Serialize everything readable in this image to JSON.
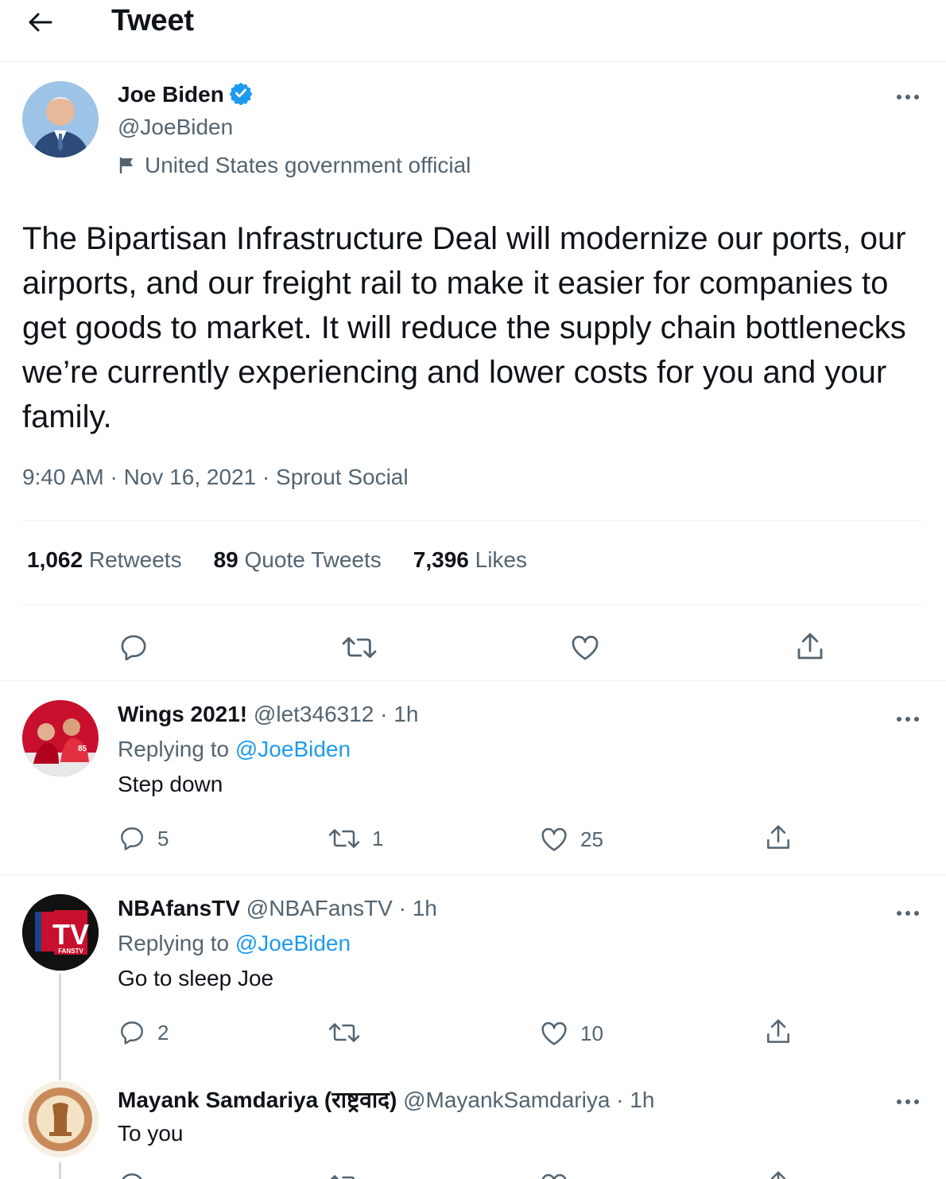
{
  "header": {
    "title": "Tweet"
  },
  "main_tweet": {
    "name": "Joe Biden",
    "handle": "@JoeBiden",
    "label": "United States government official",
    "text": "The Bipartisan Infrastructure Deal will modernize our ports, our airports, and our freight rail to make it easier for companies to get goods to market. It will reduce the supply chain bottlenecks we’re currently experiencing and lower costs for you and your family.",
    "meta": "9:40 AM · Nov 16, 2021 · Sprout Social",
    "stats": {
      "retweets_count": "1,062",
      "retweets_label": "Retweets",
      "quotes_count": "89",
      "quotes_label": "Quote Tweets",
      "likes_count": "7,396",
      "likes_label": "Likes"
    }
  },
  "replies": [
    {
      "name": "Wings 2021!",
      "handle": "@let346312",
      "time": "1h",
      "replying_prefix": "Replying to",
      "replying_to": "@JoeBiden",
      "text": "Step down",
      "reply_count": "5",
      "retweet_count": "1",
      "like_count": "25"
    },
    {
      "name": "NBAfansTV",
      "handle": "@NBAFansTV",
      "time": "1h",
      "replying_prefix": "Replying to",
      "replying_to": "@JoeBiden",
      "text": "Go to sleep Joe",
      "reply_count": "2",
      "retweet_count": "",
      "like_count": "10",
      "avatar_text": "TV",
      "avatar_subtext": "FANSTV"
    },
    {
      "name": "Mayank Samdariya (राष्ट्रवाद)",
      "handle": "@MayankSamdariya",
      "time": "1h",
      "text": "To you"
    }
  ],
  "colors": {
    "accent": "#1d9bf0",
    "secondary_text": "#536471",
    "border": "#eff3f4",
    "like_icon": "#536471"
  }
}
